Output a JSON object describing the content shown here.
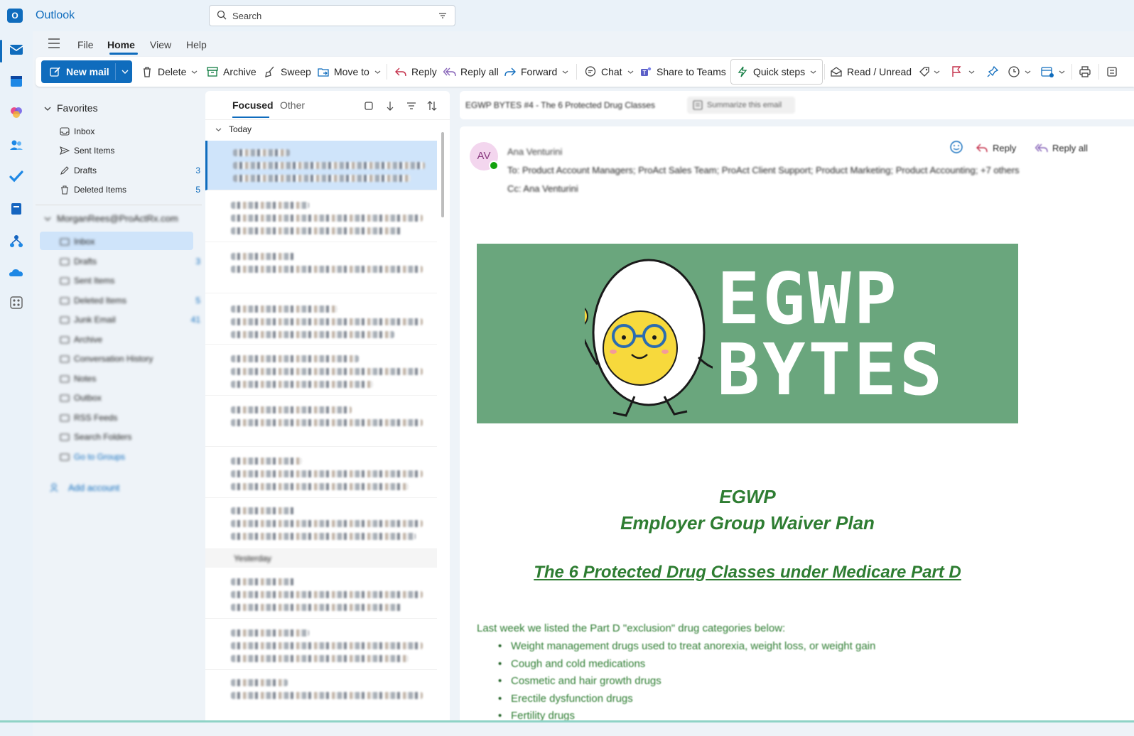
{
  "app": {
    "title": "Outlook"
  },
  "search": {
    "placeholder": "Search"
  },
  "menu": {
    "items": [
      "File",
      "Home",
      "View",
      "Help"
    ],
    "active": "Home"
  },
  "ribbon": {
    "new_mail": "New mail",
    "delete": "Delete",
    "archive": "Archive",
    "sweep": "Sweep",
    "move_to": "Move to",
    "reply": "Reply",
    "reply_all": "Reply all",
    "forward": "Forward",
    "chat": "Chat",
    "share_to_teams": "Share to Teams",
    "quick_steps": "Quick steps",
    "read_unread": "Read / Unread"
  },
  "folders": {
    "favorites_header": "Favorites",
    "favorites": [
      {
        "label": "Inbox",
        "count": ""
      },
      {
        "label": "Sent Items",
        "count": ""
      },
      {
        "label": "Drafts",
        "count": "3"
      },
      {
        "label": "Deleted Items",
        "count": "5"
      }
    ],
    "account_header": "MorganRees@ProActRx.com",
    "account_items": [
      {
        "label": "Inbox",
        "count": ""
      },
      {
        "label": "Drafts",
        "count": "3"
      },
      {
        "label": "Sent Items",
        "count": ""
      },
      {
        "label": "Deleted Items",
        "count": "5"
      },
      {
        "label": "Junk Email",
        "count": "41"
      },
      {
        "label": "Archive",
        "count": ""
      },
      {
        "label": "Conversation History",
        "count": ""
      },
      {
        "label": "Notes",
        "count": ""
      },
      {
        "label": "Outbox",
        "count": ""
      },
      {
        "label": "RSS Feeds",
        "count": ""
      },
      {
        "label": "Search Folders",
        "count": ""
      },
      {
        "label": "Go to Groups",
        "count": ""
      }
    ],
    "add_account": "Add account"
  },
  "maillist": {
    "tabs": [
      "Focused",
      "Other"
    ],
    "active_tab": "Focused",
    "group_today": "Today",
    "group_yesterday": "Yesterday"
  },
  "reading": {
    "subject": "EGWP BYTES #4 - The 6 Protected Drug Classes",
    "summarize": "Summarize this email",
    "avatar_initials": "AV",
    "sender": "Ana Venturini",
    "to_line": "To: Product Account Managers; ProAct Sales Team; ProAct Client Support; Product Marketing; Product Accounting; +7 others",
    "cc_line": "Cc: Ana Venturini",
    "action_reply": "Reply",
    "action_reply_all": "Reply all",
    "banner_word1": "EGWP",
    "banner_word2": "BYTES",
    "heading1": "EGWP",
    "heading2": "Employer Group Waiver Plan",
    "heading3": "The 6 Protected Drug Classes under Medicare Part D",
    "intro": "Last week we listed the Part D \"exclusion\" drug categories below:",
    "bullets": [
      "Weight management drugs used to treat anorexia, weight loss, or weight gain",
      "Cough and cold medications",
      "Cosmetic and hair growth drugs",
      "Erectile dysfunction drugs",
      "Fertility drugs"
    ]
  },
  "colors": {
    "accent": "#0f6cbd",
    "banner": "#6aa67d",
    "heading_green": "#2e7d32"
  }
}
